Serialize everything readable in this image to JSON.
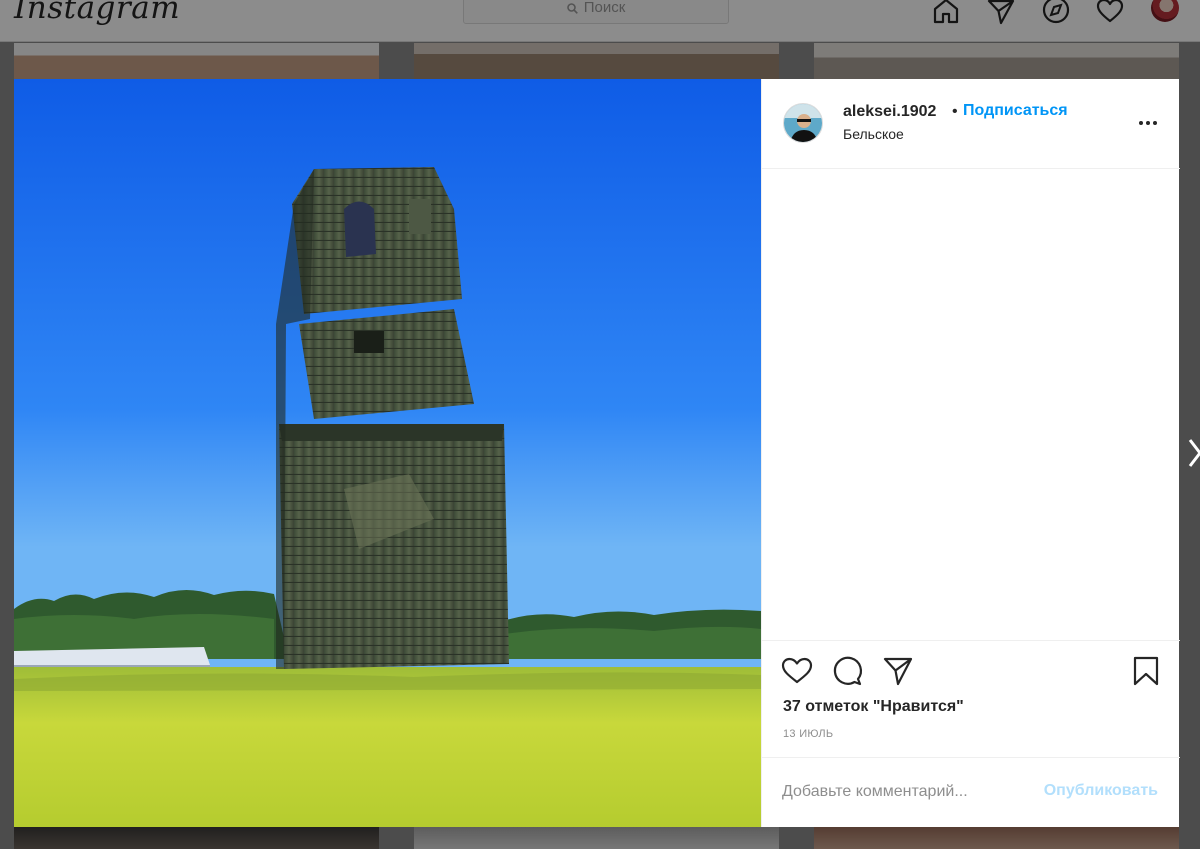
{
  "nav": {
    "logo_text": "Instagram",
    "search_placeholder": "Поиск",
    "icons": [
      "home-icon",
      "direct-icon",
      "explore-icon",
      "activity-heart-icon",
      "profile-avatar"
    ]
  },
  "post": {
    "username": "aleksei.1902",
    "separator": "•",
    "follow_label": "Подписаться",
    "location": "Бельское",
    "likes_text": "37 отметок \"Нравится\"",
    "date": "13 ИЮЛЬ",
    "comment_placeholder": "Добавьте комментарий...",
    "publish_label": "Опубликовать",
    "photo_alt": "Деревянная колокольня в поле"
  },
  "colors": {
    "accent": "#0095f6",
    "publish_disabled": "#b2dffc",
    "text": "#262626",
    "muted": "#8e8e8e",
    "sky": "#1a6cf0",
    "grass": "#c9d93a"
  }
}
